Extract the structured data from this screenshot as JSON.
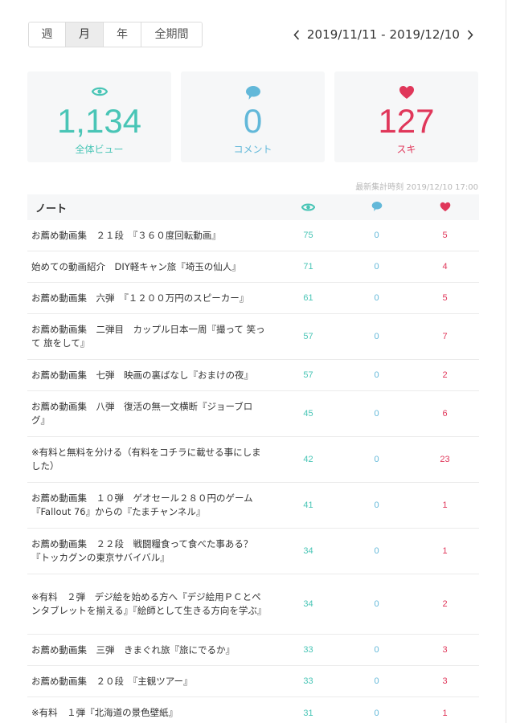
{
  "period_tabs": [
    {
      "label": "週",
      "active": false
    },
    {
      "label": "月",
      "active": true
    },
    {
      "label": "年",
      "active": false
    },
    {
      "label": "全期間",
      "active": false
    }
  ],
  "date_range": "2019/11/11 - 2019/12/10",
  "stats": {
    "views": {
      "value": "1,134",
      "label": "全体ビュー"
    },
    "comments": {
      "value": "0",
      "label": "コメント"
    },
    "likes": {
      "value": "127",
      "label": "スキ"
    }
  },
  "updated_text": "最新集計時刻 2019/12/10 17:00",
  "table": {
    "header_title": "ノート",
    "rows": [
      {
        "title": "お薦め動画集　２１段　『３６０度回転動画』",
        "views": "75",
        "comments": "0",
        "likes": "5"
      },
      {
        "title": "始めての動画紹介　DIY軽キャン旅『埼玉の仙人』",
        "views": "71",
        "comments": "0",
        "likes": "4"
      },
      {
        "title": "お薦め動画集　六弾　『１２００万円のスピーカー』",
        "views": "61",
        "comments": "0",
        "likes": "5"
      },
      {
        "title": "お薦め動画集　二弾目　カップル日本一周『撮って 笑って 旅をして』",
        "views": "57",
        "comments": "0",
        "likes": "7"
      },
      {
        "title": "お薦め動画集　七弾　映画の裏ばなし『おまけの夜』",
        "views": "57",
        "comments": "0",
        "likes": "2"
      },
      {
        "title": "お薦め動画集　八弾　復活の無一文横断『ジョーブログ』",
        "views": "45",
        "comments": "0",
        "likes": "6"
      },
      {
        "title": "※有料と無料を分ける（有料をコチラに載せる事にしました）",
        "views": "42",
        "comments": "0",
        "likes": "23"
      },
      {
        "title": "お薦め動画集　１０弾　ゲオセール２８０円のゲーム『Fallout 76』からの『たまチャンネル』",
        "views": "41",
        "comments": "0",
        "likes": "1"
      },
      {
        "title": "お薦め動画集　２２段　戦闘糧食って食べた事ある？『トッカグンの東京サバイバル』",
        "views": "34",
        "comments": "0",
        "likes": "1"
      },
      {
        "title": "※有料　２弾　デジ絵を始める方へ『デジ絵用ＰＣとペンタブレットを揃える』『絵師として生きる方向を学ぶ』",
        "views": "34",
        "comments": "0",
        "likes": "2"
      },
      {
        "title": "お薦め動画集　三弾　きまぐれ旅『旅にでるか』",
        "views": "33",
        "comments": "0",
        "likes": "3"
      },
      {
        "title": "お薦め動画集　２０段　『主観ツアー』",
        "views": "33",
        "comments": "0",
        "likes": "3"
      },
      {
        "title": "※有料　１弾『北海道の景色壁紙』",
        "views": "31",
        "comments": "0",
        "likes": "1"
      }
    ]
  },
  "colors": {
    "views": "#49c5b6",
    "comments": "#62b8d9",
    "likes": "#e0375a"
  },
  "icons": {
    "views": "eye-icon",
    "comments": "speech-bubble-icon",
    "likes": "heart-icon",
    "prev": "chevron-left-icon",
    "next": "chevron-right-icon"
  }
}
